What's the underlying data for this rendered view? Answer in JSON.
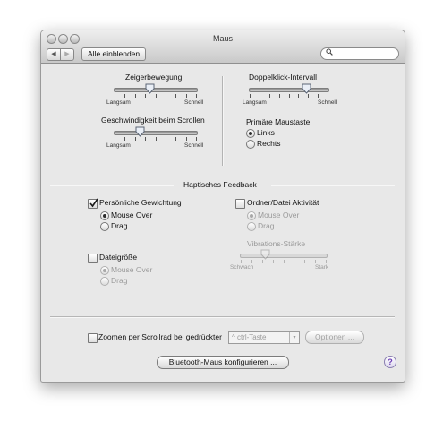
{
  "window": {
    "title": "Maus"
  },
  "toolbar": {
    "back_label": "◀",
    "forward_label": "▶",
    "show_all_label": "Alle einblenden",
    "search_placeholder": "",
    "search_glyph": "🔍"
  },
  "pointer": {
    "title": "Zeigerbewegung",
    "min_label": "Langsam",
    "max_label": "Schnell",
    "level": 0.45
  },
  "doubleclick": {
    "title": "Doppelklick-Intervall",
    "min_label": "Langsam",
    "max_label": "Schnell",
    "level": 0.7
  },
  "scroll": {
    "title": "Geschwindigkeit beim Scrollen",
    "min_label": "Langsam",
    "max_label": "Schnell",
    "level": 0.33
  },
  "primary_button": {
    "title": "Primäre Maustaste:",
    "options": [
      "Links",
      "Rechts"
    ],
    "selected": "Links"
  },
  "haptic": {
    "section_title": "Haptisches Feedback",
    "personal_weighting": {
      "label": "Persönliche Gewichtung",
      "checked": true,
      "options": [
        "Mouse Over",
        "Drag"
      ],
      "selected": "Mouse Over"
    },
    "folder_file_activity": {
      "label": "Ordner/Datei Aktivität",
      "checked": false,
      "options": [
        "Mouse Over",
        "Drag"
      ],
      "selected": "Mouse Over"
    },
    "file_size": {
      "label": "Dateigröße",
      "checked": false,
      "options": [
        "Mouse Over",
        "Drag"
      ],
      "selected": "Mouse Over"
    },
    "vibration": {
      "title": "Vibrations-Stärke",
      "min_label": "Schwach",
      "max_label": "Stark",
      "level": 0.25
    }
  },
  "zoom": {
    "label": "Zoomen per Scrollrad bei gedrückter",
    "checked": false,
    "modifier_value": "^ ctrl-Taste",
    "options_button": "Optionen ..."
  },
  "bluetooth_button": "Bluetooth-Maus konfigurieren ...",
  "help_label": "?",
  "colors": {
    "help_accent": "#6b3db5"
  }
}
